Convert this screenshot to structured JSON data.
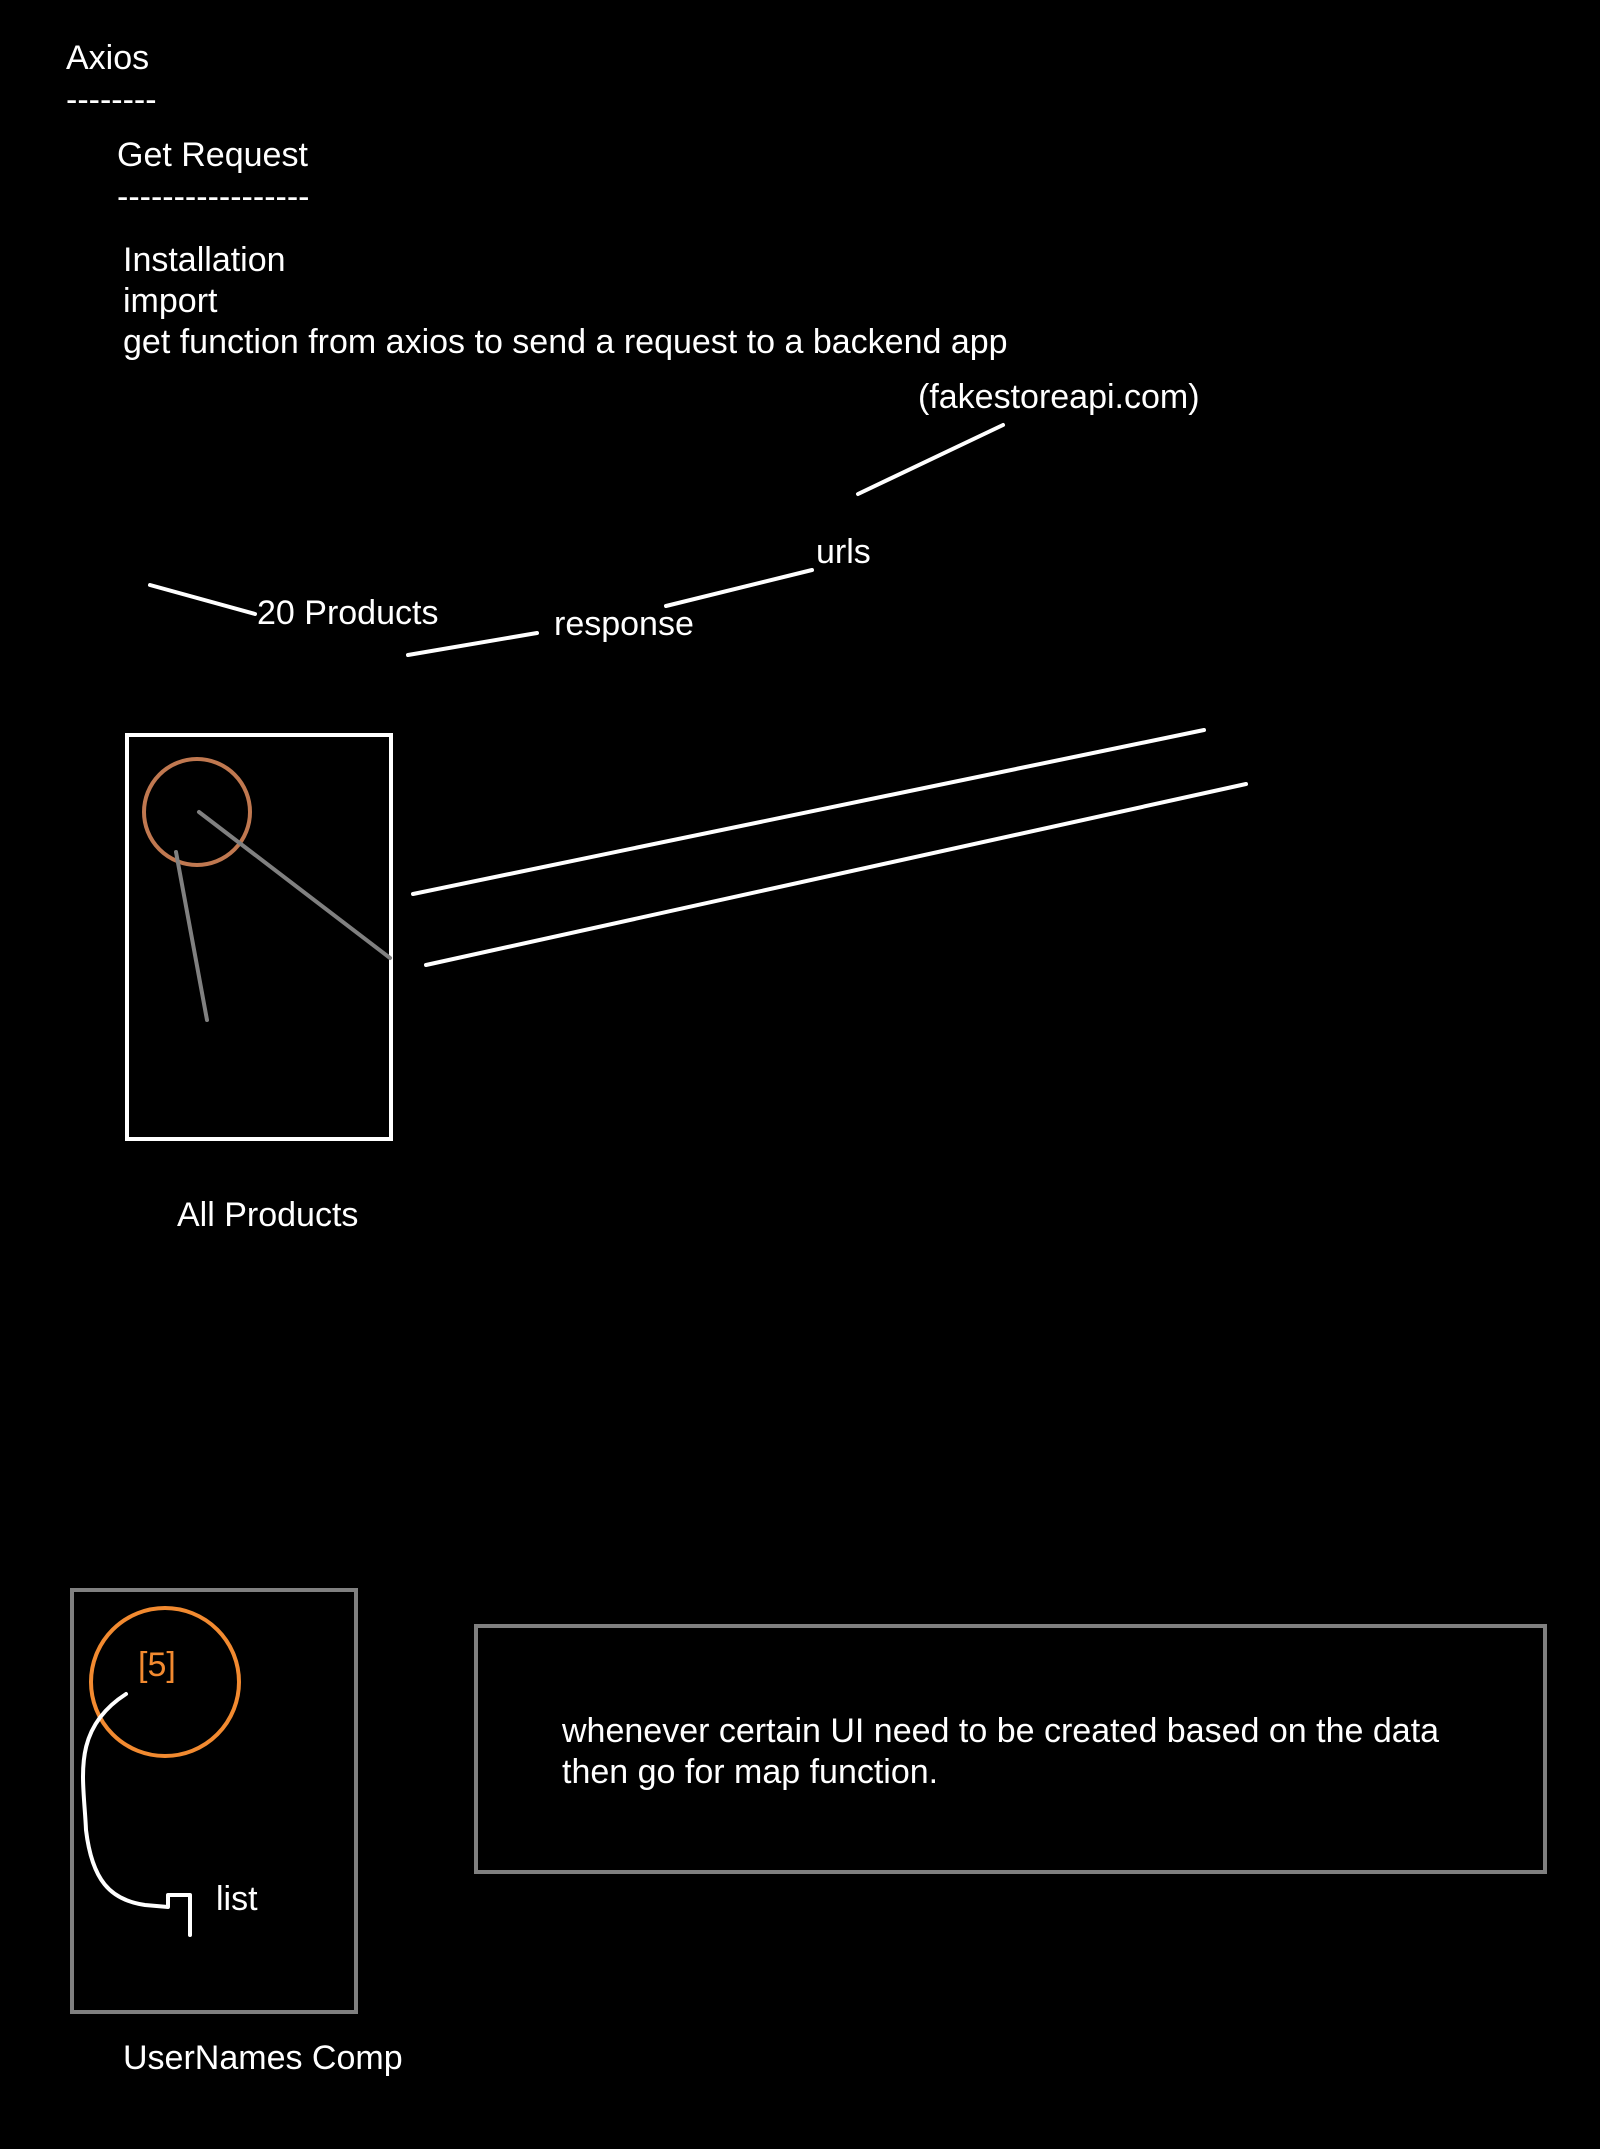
{
  "notes": {
    "title": "Axios",
    "title_underline": "--------",
    "subtitle": "Get Request",
    "subtitle_underline": "-----------------",
    "steps": [
      "Installation",
      "import",
      "get function from axios to send a request to a backend app"
    ]
  },
  "diagram": {
    "backend_label": "(fakestoreapi.com)",
    "urls_label": "urls",
    "response_label": "response",
    "products_label": "20 Products",
    "all_products_caption": "All Products",
    "array_label": "[5]",
    "list_label": "list",
    "usernames_caption": "UserNames Comp"
  },
  "callout": {
    "line1": "whenever certain UI need to be created based on the data",
    "line2": "then go for map function."
  },
  "colors": {
    "background": "#000000",
    "ink": "#ffffff",
    "gray_ink": "#808080",
    "brown_ink": "#c07850",
    "orange_ink": "#f28a30"
  }
}
